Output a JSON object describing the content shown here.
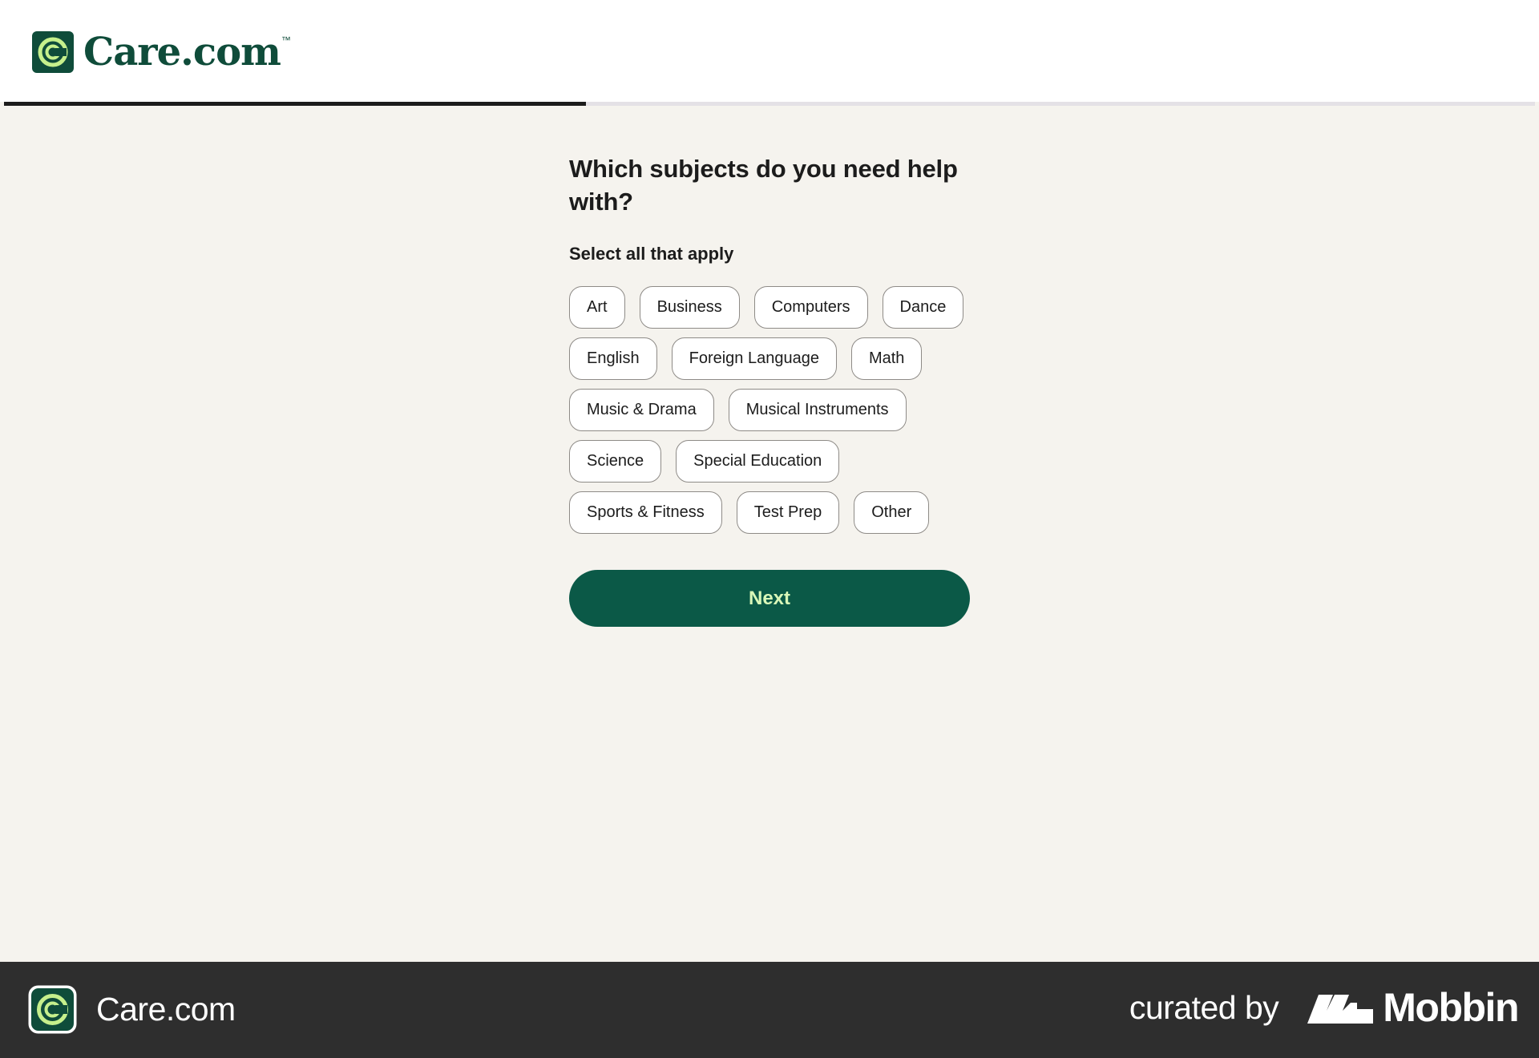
{
  "header": {
    "logo_text": "Care.com",
    "logo_trademark": "™",
    "logo_icon": "care-logo-icon"
  },
  "progress": {
    "fraction": 0.38
  },
  "main": {
    "title": "Which subjects do you need help with?",
    "subtitle": "Select all that apply",
    "subjects": [
      "Art",
      "Business",
      "Computers",
      "Dance",
      "English",
      "Foreign Language",
      "Math",
      "Music & Drama",
      "Musical Instruments",
      "Science",
      "Special Education",
      "Sports & Fitness",
      "Test Prep",
      "Other"
    ],
    "next_label": "Next"
  },
  "footer": {
    "app_name": "Care.com",
    "curated_label": "curated by",
    "brand_name": "Mobbin"
  },
  "colors": {
    "brand_green": "#0b5947",
    "next_text": "#d9f7b8",
    "page_background": "#f5f3ee",
    "footer_background": "#2e2e2e"
  }
}
